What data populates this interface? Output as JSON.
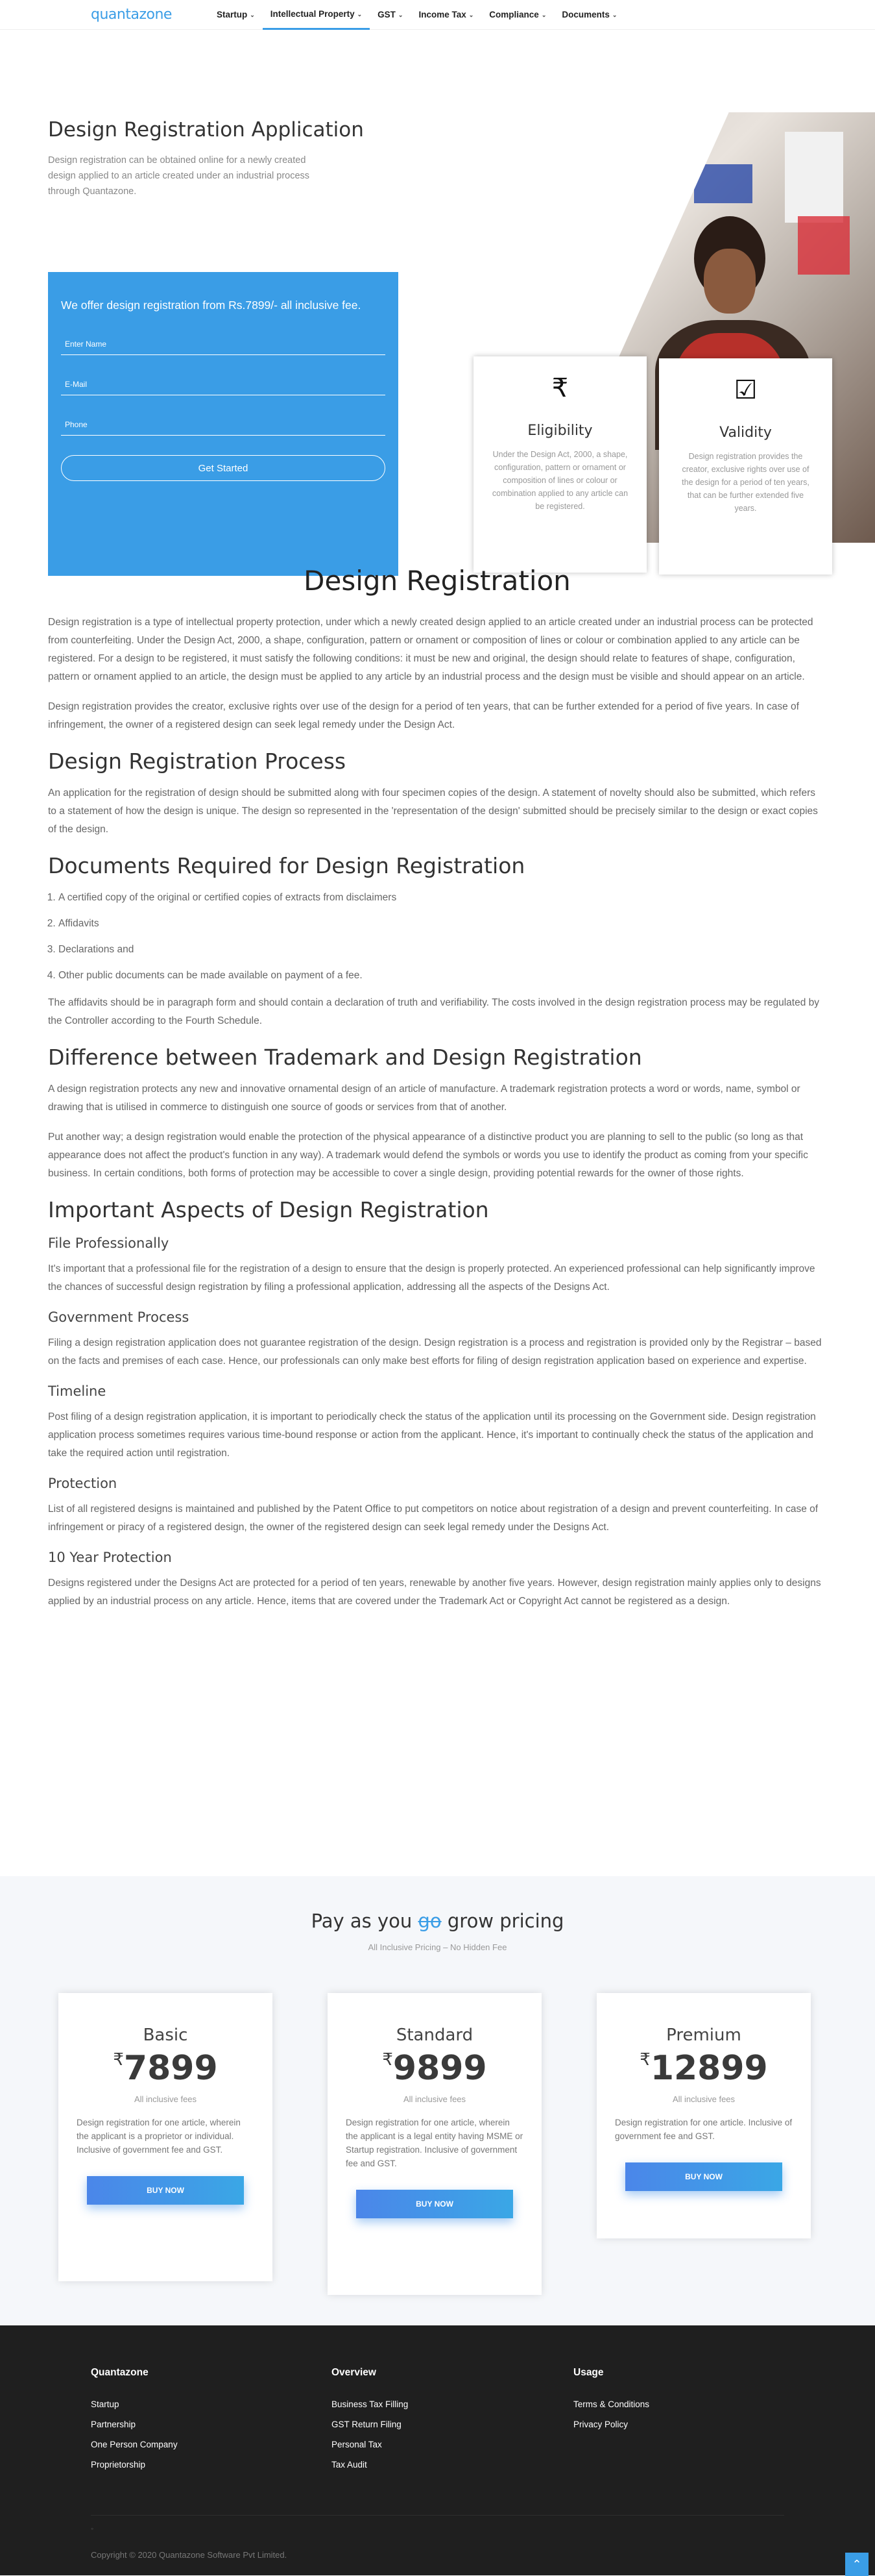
{
  "nav": {
    "logo": "quantazone",
    "items": [
      {
        "label": "Startup",
        "active": false
      },
      {
        "label": "Intellectual Property",
        "active": true
      },
      {
        "label": "GST",
        "active": false
      },
      {
        "label": "Income Tax",
        "active": false
      },
      {
        "label": "Compliance",
        "active": false
      },
      {
        "label": "Documents",
        "active": false
      }
    ]
  },
  "hero": {
    "title": "Design Registration Application",
    "subtitle": "Design registration can be obtained online for a newly created design applied to an article created under an industrial process through Quantazone."
  },
  "form": {
    "offer": "We offer design registration from Rs.7899/- all inclusive fee.",
    "name_placeholder": "Enter Name",
    "email_placeholder": "E-Mail",
    "phone_placeholder": "Phone",
    "submit_label": "Get Started"
  },
  "cards": {
    "eligibility": {
      "icon": "rupee-icon",
      "title": "Eligibility",
      "text": "Under the Design Act, 2000, a shape, configuration, pattern or ornament or composition of lines or colour or combination applied to any article can be registered."
    },
    "validity": {
      "icon": "checkbox-icon",
      "title": "Validity",
      "text": "Design registration provides the creator, exclusive rights over use of the design for a period of ten years, that can be further extended five years."
    }
  },
  "content": {
    "main_title": "Design Registration",
    "intro_p1": "Design registration is a type of intellectual property protection, under which a newly created design applied to an article created under an industrial process can be protected from counterfeiting. Under the Design Act, 2000, a shape, configuration, pattern or ornament or composition of lines or colour or combination applied to any article can be registered. For a design to be registered, it must satisfy the following conditions: it must be new and original, the design should relate to features of shape, configuration, pattern or ornament applied to an article, the design must be applied to any article by an industrial process and the design must be visible and should appear on an article.",
    "intro_p2": "Design registration provides the creator, exclusive rights over use of the design for a period of ten years, that can be further extended for a period of five years. In case of infringement, the owner of a registered design can seek legal remedy under the Design Act.",
    "process_title": "Design Registration Process",
    "process_p": "An application for the registration of design should be submitted along with four specimen copies of the design. A statement of novelty should also be submitted, which refers to a statement of how the design is unique. The design so represented in the 'representation of the design' submitted should be precisely similar to the design or exact copies of the design.",
    "docs_title": "Documents Required for Design Registration",
    "docs_list": [
      "A certified copy of the original or certified copies of extracts from disclaimers",
      "Affidavits",
      "Declarations and",
      "Other public documents can be made available on payment of a fee."
    ],
    "docs_p": "The affidavits should be in paragraph form and should contain a declaration of truth and verifiability. The costs involved in the design registration process may be regulated by the Controller according to the Fourth Schedule.",
    "diff_title": "Difference between Trademark and Design Registration",
    "diff_p1": "A design registration protects any new and innovative ornamental design of an article of manufacture. A trademark registration protects a word or words, name, symbol or drawing that is utilised in commerce to distinguish one source of goods or services from that of another.",
    "diff_p2": "Put another way; a design registration would enable the protection of the physical appearance of a distinctive product you are planning to sell to the public (so long as that appearance does not affect the product's function in any way). A trademark would defend the symbols or words you use to identify the product as coming from your specific business. In certain conditions, both forms of protection may be accessible to cover a single design, providing potential rewards for the owner of those rights.",
    "aspects_title": "Important Aspects of Design Registration",
    "aspects": [
      {
        "title": "File Professionally",
        "text": "It's important that a professional file for the registration of a design to ensure that the design is properly protected. An experienced professional can help significantly improve the chances of successful design registration by filing a professional application, addressing all the aspects of the Designs Act."
      },
      {
        "title": "Government Process",
        "text": "Filing a design registration application does not guarantee registration of the design. Design registration is a process and registration is provided only by the Registrar – based on the facts and premises of each case. Hence, our professionals can only make best efforts for filing of design registration application based on experience and expertise."
      },
      {
        "title": "Timeline",
        "text": "Post filing of a design registration application, it is important to periodically check the status of the application until its processing on the Government side. Design registration application process sometimes requires various time-bound response or action from the applicant. Hence, it's important to continually check the status of the application and take the required action until registration."
      },
      {
        "title": "Protection",
        "text": "List of all registered designs is maintained and published by the Patent Office to put competitors on notice about registration of a design and prevent counterfeiting. In case of infringement or piracy of a registered design, the owner of the registered design can seek legal remedy under the Designs Act."
      },
      {
        "title": "10 Year Protection",
        "text": "Designs registered under the Designs Act are protected for a period of ten years, renewable by another five years. However, design registration mainly applies only to designs applied by an industrial process on any article. Hence, items that are covered under the Trademark Act or Copyright Act cannot be registered as a design."
      }
    ]
  },
  "pricing": {
    "heading_pre": "Pay as you ",
    "heading_strike": "go",
    "heading_post": " grow pricing",
    "subheading": "All Inclusive Pricing – No Hidden Fee",
    "currency": "₹",
    "plans": [
      {
        "name": "Basic",
        "price": "7899",
        "fee_note": "All inclusive fees",
        "desc": "Design registration for one article, wherein the applicant is a proprietor or individual. Inclusive of government fee and GST.",
        "button": "BUY NOW"
      },
      {
        "name": "Standard",
        "price": "9899",
        "fee_note": "All inclusive fees",
        "desc": "Design registration for one article, wherein the applicant is a legal entity having MSME or Startup registration. Inclusive of government fee and GST.",
        "button": "BUY NOW"
      },
      {
        "name": "Premium",
        "price": "12899",
        "fee_note": "All inclusive fees",
        "desc": "Design registration for one article. Inclusive of government fee and GST.",
        "button": "BUY NOW"
      }
    ]
  },
  "footer": {
    "columns": [
      {
        "heading": "Quantazone",
        "links": [
          "Startup",
          "Partnership",
          "One Person Company",
          "Proprietorship"
        ]
      },
      {
        "heading": "Overview",
        "links": [
          "Business Tax Filling",
          "GST Return Filing",
          "Personal Tax",
          "Tax Audit"
        ]
      },
      {
        "heading": "Usage",
        "links": [
          "Terms & Conditions",
          "Privacy Policy"
        ]
      }
    ],
    "copyright": "Copyright © 2020 Quantazone Software Pvt Limited."
  },
  "colors": {
    "accent": "#3a9de6",
    "footer_bg": "#1f1f1f",
    "pricing_bg": "#f5f7fa"
  }
}
